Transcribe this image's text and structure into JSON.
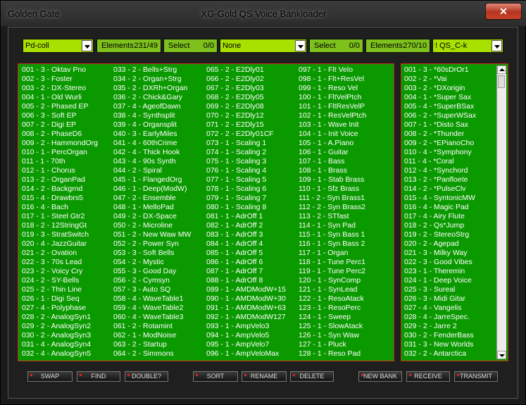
{
  "window": {
    "app_name": "Golden Gate",
    "title": "XG-Gold QS Voice Bankloader",
    "close_label": "✕"
  },
  "toolbar": {
    "left_select": "Pd-coll",
    "left_elements_label": "Elements",
    "left_elements_value": "231/49",
    "left_select_label": "Select",
    "left_select_count": "0/0",
    "middle_select": "None",
    "right_select_label": "Select",
    "right_select_count": "0/0",
    "right_elements_label": "Elements",
    "right_elements_value": "270/10",
    "right_select": "! QS_C-k"
  },
  "left_list": {
    "col1": [
      "001 - 3 - Oktav Pno",
      "002 - 3 - Foster",
      "003 - 2 - DX-Stereo",
      "004 - 1 - Old Wurli",
      "005 - 2 - Phased EP",
      "006 - 3 - Soft EP",
      "007 - 2 - Digi EP",
      "008 - 2 - PhaseD6",
      "009 - 2 - HammondOrg",
      "010 - 1 - PercOrgan",
      "011 - 1 - 70th",
      "012 - 1 - Chorus",
      "013 - 2 - OrganPad",
      "014 - 2 - Backgrnd",
      "015 - 4 - Drawbrs5",
      "016 - 4 - Bach",
      "017 - 1 - Steel Gtr2",
      "018 - 2 - 12StringGt",
      "019 - 3 - StratSwitch",
      "020 - 4 - JazzGuitar",
      "021 - 2 - Ovation",
      "022 - 3 - 70s Lead",
      "023 - 2 - Voicy Cry",
      "024 - 2 - SY-Bells",
      "025 - 2 - Thin Line",
      "026 - 1 - Digi Seq",
      "027 - 4 - Polyphase",
      "028 - 2 - AnalogSyn1",
      "029 - 2 - AnalogSyn2",
      "030 - 2 - AnalogSyn3",
      "031 - 4 - AnalogSyn4",
      "032 - 4 - AnalogSyn5"
    ],
    "col2": [
      "033 - 2 - Bells+Strg",
      "034 - 2 - Organ+Strg",
      "035 - 2 - DXRh+Organ",
      "036 - 2 - Chick&Gary",
      "037 - 4 - AgeofDawn",
      "038 - 4 - Synthsplit",
      "039 - 4 - Organsplit",
      "040 - 3 - EarlyMiles",
      "041 - 4 - 60thCrime",
      "042 - 4 - Thick Hook",
      "043 - 4 - 90s Synth",
      "044 - 2 - Spiral",
      "045 - 1 - FlangedOrg",
      "046 - 1 - Deep(ModW)",
      "047 - 2 - Ensemble",
      "048 - 1 - MelloPad",
      "049 - 2 - DX-Space",
      "050 - 2 - Microline",
      "051 - 2 - New Waw MW",
      "052 - 2 - Power Syn",
      "053 - 3 - Soft Bells",
      "054 - 2 - Mystic",
      "055 - 3 - Good Day",
      "056 - 2 - Cymsyn",
      "057 - 3 - Auto SQ",
      "058 - 4 - WaveTable1",
      "059 - 4 - WaveTable2",
      "060 - 4 - WaveTable3",
      "061 - 2 - Rotamint",
      "062 - 1 - ModNoise",
      "063 - 2 - Startup",
      "064 - 2 - Simmons"
    ],
    "col3": [
      "065 - 2 - E2Dly01",
      "066 - 2 - E2Dly02",
      "067 - 2 - E2Dly03",
      "068 - 2 - E2Dly05",
      "069 - 2 - E2Dly08",
      "070 - 2 - E2Dly12",
      "071 - 2 - E2Dly15",
      "072 - 2 - E2Dly01CF",
      "073 - 1 - Scaling 1",
      "074 - 1 - Scaling 2",
      "075 - 1 - Scaling 3",
      "076 - 1 - Scaling 4",
      "077 - 1 - Scaling 5",
      "078 - 1 - Scaling 6",
      "079 - 1 - Scaling 7",
      "080 - 1 - Scaling 8",
      "081 - 1 - AdrOff 1",
      "082 - 1 - AdrOff 2",
      "083 - 1 - AdrOff 3",
      "084 - 1 - AdrOff 4",
      "085 - 1 - AdrOff 5",
      "086 - 1 - AdrOff 6",
      "087 - 1 - AdrOff 7",
      "088 - 1 - AdrOff 8",
      "089 - 1 - AMDModW+15",
      "090 - 1 - AMDModW+30",
      "091 - 1 - AMDModW+63",
      "092 - 1 - AMDModW127",
      "093 - 1 - AmpVelo3",
      "094 - 1 - AmpVelo5",
      "095 - 1 - AmpVelo7",
      "096 - 1 - AmpVeloMax"
    ],
    "col4": [
      "097 - 1 - Flt Velo",
      "098 - 1 - Flt+ResVel",
      "099 - 1 - Reso Vel",
      "100 - 1 - FltVelPtch",
      "101 - 1 - FltResVelP",
      "102 - 1 - ResVelPtch",
      "103 - 1 - Wave Init",
      "104 - 1 - Init Voice",
      "105 - 1 - A.Piano",
      "106 - 1 - Guitar",
      "107 - 1 - Bass",
      "108 - 1 - Brass",
      "109 - 1 - Stab Brass",
      "110 - 1 - Sfz Brass",
      "111 - 2 - Syn Brass1",
      "112 - 2 - Syn Brass2",
      "113 - 2 - STfast",
      "114 - 1 - Syn Pad",
      "115 - 1 - Syn Bass 1",
      "116 - 1 - Syn Bass 2",
      "117 - 1 - Organ",
      "118 - 1 - Tune Perc1",
      "119 - 1 - Tune Perc2",
      "120 - 1 - SynComp",
      "121 - 1 - SynLead",
      "122 - 1 - ResoAtack",
      "123 - 1 - ResoPerc",
      "124 - 1 - Sweep",
      "125 - 1 - SlowAtack",
      "126 - 1 - Syn Waw",
      "127 - 1 - Pluck",
      "128 - 1 - Reso Pad"
    ]
  },
  "right_list": [
    "001 - 3 - *60sDrOr1",
    "002 - 2 - *Vai",
    "003 - 2 - *DXorigin",
    "004 - 1 - *Super Sax",
    "005 - 4 - *SuperBSax",
    "006 - 2 - *SuperWSax",
    "007 - 1 - *Disto Sax",
    "008 - 2 - *Thunder",
    "009 - 2 - *EPianoCho",
    "010 - 4 - *Symphony",
    "011 - 4 - *Coral",
    "012 - 4 - *Synchord",
    "013 - 2 - *Panfloete",
    "014 - 2 - *PulseClv",
    "015 - 4 - SyntonicMW",
    "016 - 4 - Magic Pad",
    "017 - 4 - Airy Flute",
    "018 - 2 - Qs*Jump",
    "019 - 2 - StereoStrg",
    "020 - 2 - Agepad",
    "021 - 3 - Milky Way",
    "022 - 3 - Good Vibes",
    "023 - 1 - Theremin",
    "024 - 1 - Deep Voice",
    "025 - 3 - Sureal",
    "026 - 3 - Midi Gitar",
    "027 - 4 - Vangelis",
    "028 - 4 - JarreSpec.",
    "029 - 2 - Jarre 2",
    "030 - 2 - FenderBass",
    "031 - 3 - New Worlds",
    "032 - 2 - Antarctica"
  ],
  "buttons": {
    "swap": "SWAP",
    "find": "FIND",
    "double": "DOUBLE?",
    "sort": "SORT",
    "rename": "RENAME",
    "delete": "DELETE",
    "new_bank": "NEW BANK",
    "receive": "RECEIVE",
    "transmit": "TRANSMIT"
  }
}
